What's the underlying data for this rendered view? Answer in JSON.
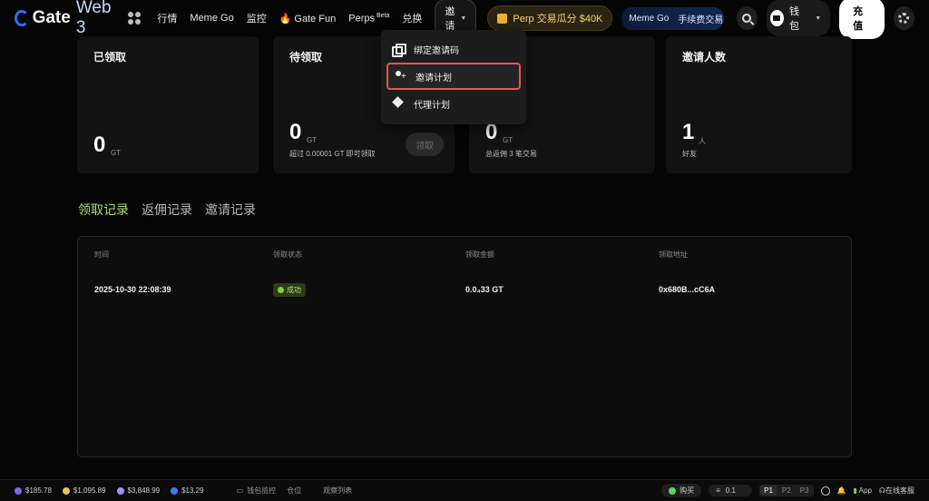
{
  "header": {
    "logo_text": "Gate",
    "logo_suffix": "Web 3",
    "nav": [
      "行情",
      "Meme Go",
      "监控"
    ],
    "gate_fun": "Gate Fun",
    "perps": "Perps",
    "perps_badge": "Beta",
    "swap": "兑换",
    "invite": "邀请",
    "promo": "Perp 交易瓜分 $40K",
    "meme_banner": "Meme Go",
    "meme_banner_sub": "手续费交易",
    "wallet": "钱包",
    "deposit": "充值"
  },
  "dropdown": {
    "items": [
      "绑定邀请码",
      "邀请计划",
      "代理计划"
    ]
  },
  "cards": {
    "claimed": {
      "title": "已领取",
      "value": "0",
      "unit": "GT"
    },
    "pending": {
      "title": "待领取",
      "value": "0",
      "unit": "GT",
      "note": "超过 0.00001 GT 即可领取",
      "button": "领取"
    },
    "rebate": {
      "value": "0",
      "unit": "GT",
      "note": "总返佣 3 笔交易"
    },
    "invites": {
      "title": "邀请人数",
      "value": "1",
      "unit": "人",
      "note": "好友"
    }
  },
  "tabs": [
    "领取记录",
    "返佣记录",
    "邀请记录"
  ],
  "table": {
    "columns": [
      "时间",
      "领取状态",
      "领取金额",
      "领取地址"
    ],
    "rows": [
      {
        "time": "2025-10-30 22:08:39",
        "status": "成功",
        "amount": "0.0₄33 GT",
        "address": "0x680B...cC6A"
      }
    ]
  },
  "footer": {
    "tickers": [
      {
        "value": "$185.78",
        "color": "#6f6cf0"
      },
      {
        "value": "$1,095.89",
        "color": "#e8c25a"
      },
      {
        "value": "$3,848.99",
        "color": "#8e9cf5"
      },
      {
        "value": "$13.29",
        "color": "#3c7bf5"
      }
    ],
    "links": [
      "钱包监控",
      "仓位",
      "观察列表"
    ],
    "buy": "购买",
    "amount": "0.1",
    "presets": [
      "P1",
      "P2",
      "P3"
    ],
    "app": "App",
    "support": "在线客服"
  }
}
